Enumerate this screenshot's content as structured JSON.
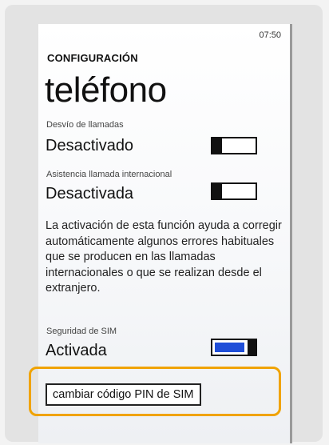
{
  "status": {
    "time": "07:50"
  },
  "header": {
    "app_title": "CONFIGURACIÓN",
    "page_title": "teléfono"
  },
  "settings": {
    "forward": {
      "label": "Desvío de llamadas",
      "value": "Desactivado",
      "on": false
    },
    "intl": {
      "label": "Asistencia llamada internacional",
      "value": "Desactivada",
      "on": false,
      "description": "La activación de esta función ayuda a corregir automáticamente algunos errores habituales que se producen en las llamadas internacionales o que se realizan desde el extranjero."
    },
    "sim": {
      "label": "Seguridad de SIM",
      "value": "Activada",
      "on": true
    }
  },
  "actions": {
    "change_pin": "cambiar código PIN de SIM"
  },
  "colors": {
    "highlight": "#f0a300",
    "toggle_on": "#1f4ed8"
  }
}
